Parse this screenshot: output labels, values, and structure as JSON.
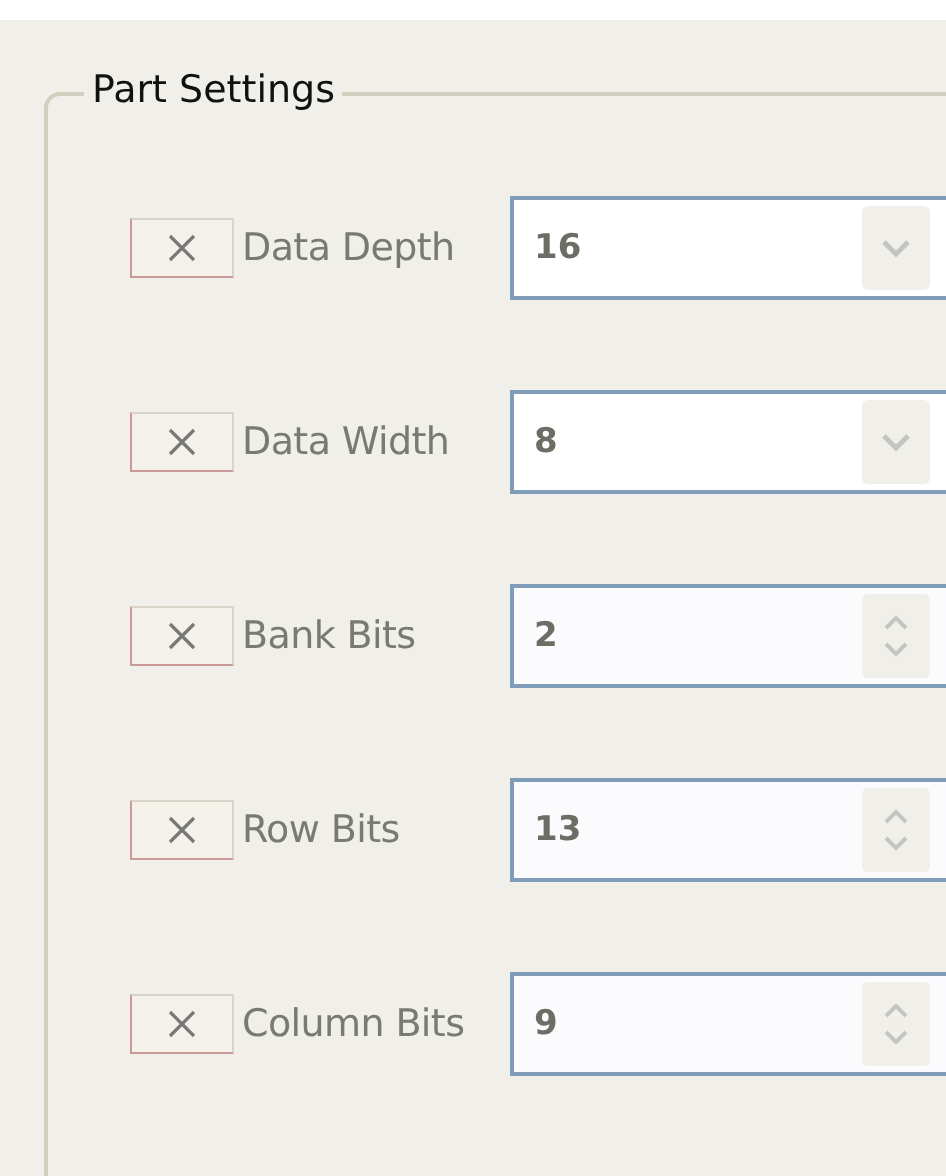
{
  "group": {
    "title": "Part Settings"
  },
  "settings": [
    {
      "label": "Data Depth",
      "kind": "combo",
      "checked": true,
      "value": "16"
    },
    {
      "label": "Data Width",
      "kind": "combo",
      "checked": true,
      "value": "8"
    },
    {
      "label": "Bank Bits",
      "kind": "spin",
      "checked": true,
      "value": "2"
    },
    {
      "label": "Row Bits",
      "kind": "spin",
      "checked": true,
      "value": "13"
    },
    {
      "label": "Column Bits",
      "kind": "spin",
      "checked": true,
      "value": "9"
    }
  ]
}
